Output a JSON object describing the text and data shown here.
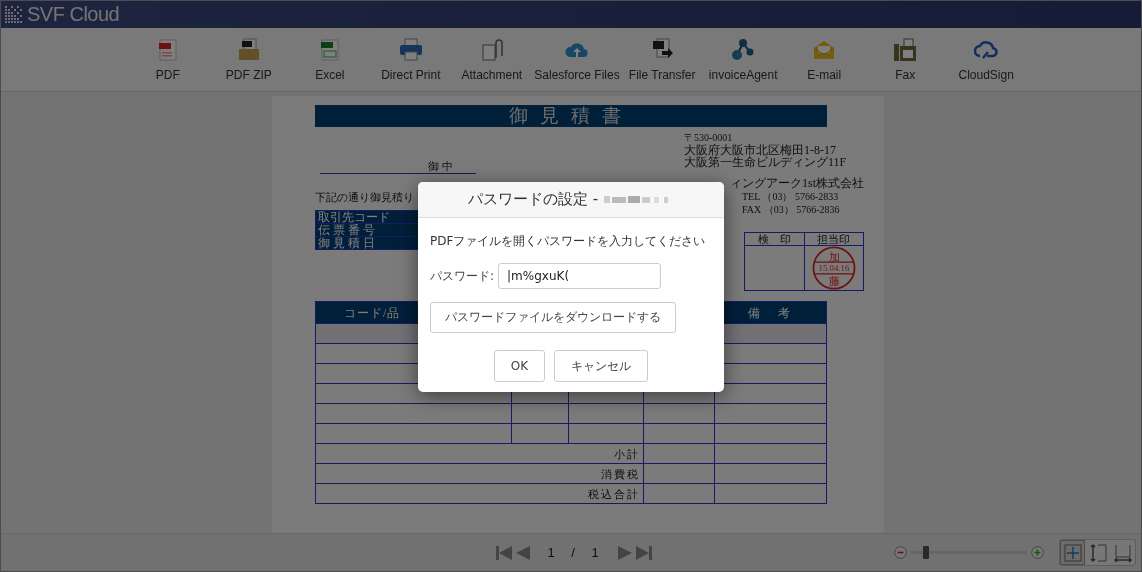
{
  "app": {
    "title": "SVF Cloud"
  },
  "toolbar": [
    {
      "label": "PDF",
      "kind": "pdf"
    },
    {
      "label": "PDF ZIP",
      "kind": "zip"
    },
    {
      "label": "Excel",
      "kind": "excel"
    },
    {
      "label": "Direct Print",
      "kind": "print"
    },
    {
      "label": "Attachment",
      "kind": "attachment"
    },
    {
      "label": "Salesforce Files",
      "kind": "cloud-upload"
    },
    {
      "label": "File Transfer",
      "kind": "transfer"
    },
    {
      "label": "invoiceAgent",
      "kind": "nodes"
    },
    {
      "label": "E-mail",
      "kind": "mail"
    },
    {
      "label": "Fax",
      "kind": "fax"
    },
    {
      "label": "CloudSign",
      "kind": "cloud-pen"
    }
  ],
  "document": {
    "title": "御見積書",
    "postal": "〒530-0001",
    "address": [
      "大阪府大阪市北区梅田1-8-17",
      "大阪第一生命ビルディング11F"
    ],
    "addressee_suffix": "御中",
    "company": "ィングアーク1st株式会社",
    "tel": "TEL （03） 5766-2833",
    "fax": "FAX （03） 5766-2836",
    "intro": "下記の通り御見積り",
    "info_labels": [
      "取引先コード",
      "伝 票 番 号",
      "御 見 積 日"
    ],
    "stamp_headers": [
      "検　印",
      "担当印"
    ],
    "stamp": {
      "top": "加",
      "date": "15.04.16",
      "bottom": "藤"
    },
    "item_header": "コード/品",
    "remarks_header": "備　考",
    "totals": [
      "小計",
      "消費税",
      "税込合計"
    ]
  },
  "dialog": {
    "title": "パスワードの設定 -",
    "prompt": "PDFファイルを開くパスワードを入力してください",
    "password_label": "パスワード:",
    "password_value": "|m%gxuK(",
    "download_button": "パスワードファイルをダウンロードする",
    "buttons": [
      "OK",
      "キャンセル"
    ]
  },
  "pager": {
    "current": "1",
    "separator": "/",
    "total": "1"
  },
  "zoom": {
    "level": 0.1
  },
  "view_modes": [
    {
      "kind": "fit-page",
      "selected": true
    },
    {
      "kind": "fit-height",
      "selected": false
    },
    {
      "kind": "fit-width",
      "selected": false
    }
  ]
}
